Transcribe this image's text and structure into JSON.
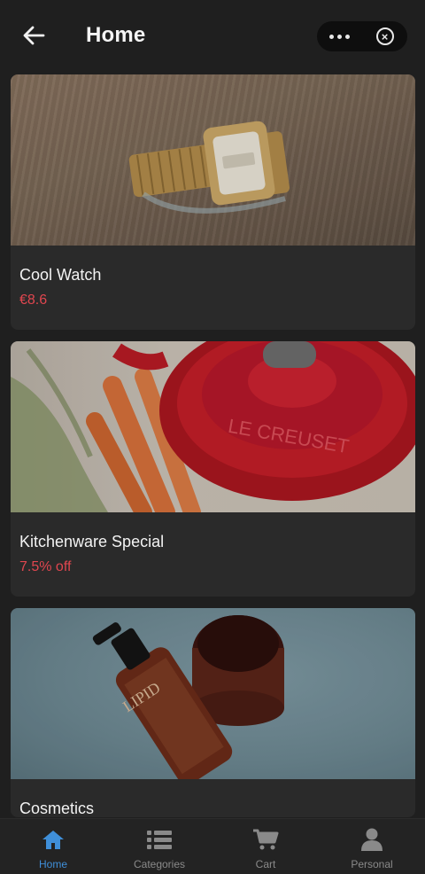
{
  "header": {
    "title": "Home",
    "back_icon": "arrow-left-icon",
    "more_icon": "more-dots-icon",
    "close_icon": "close-circle-icon"
  },
  "cards": [
    {
      "title": "Cool Watch",
      "subtitle": "€8.6",
      "image": "wristwatch-photo"
    },
    {
      "title": "Kitchenware Special",
      "subtitle": "7.5% off",
      "image": "cookware-pot-photo"
    },
    {
      "title": "Cosmetics",
      "subtitle": "",
      "image": "cosmetics-bottles-photo"
    }
  ],
  "tabbar": {
    "items": [
      {
        "label": "Home",
        "icon": "home-icon",
        "active": true
      },
      {
        "label": "Categories",
        "icon": "list-icon",
        "active": false
      },
      {
        "label": "Cart",
        "icon": "cart-icon",
        "active": false
      },
      {
        "label": "Personal",
        "icon": "person-icon",
        "active": false
      }
    ]
  },
  "colors": {
    "background": "#1f1f1f",
    "card": "#2a2a2a",
    "price": "#e0464f",
    "accent": "#3f8fd9",
    "inactive": "#8a8a8a"
  }
}
